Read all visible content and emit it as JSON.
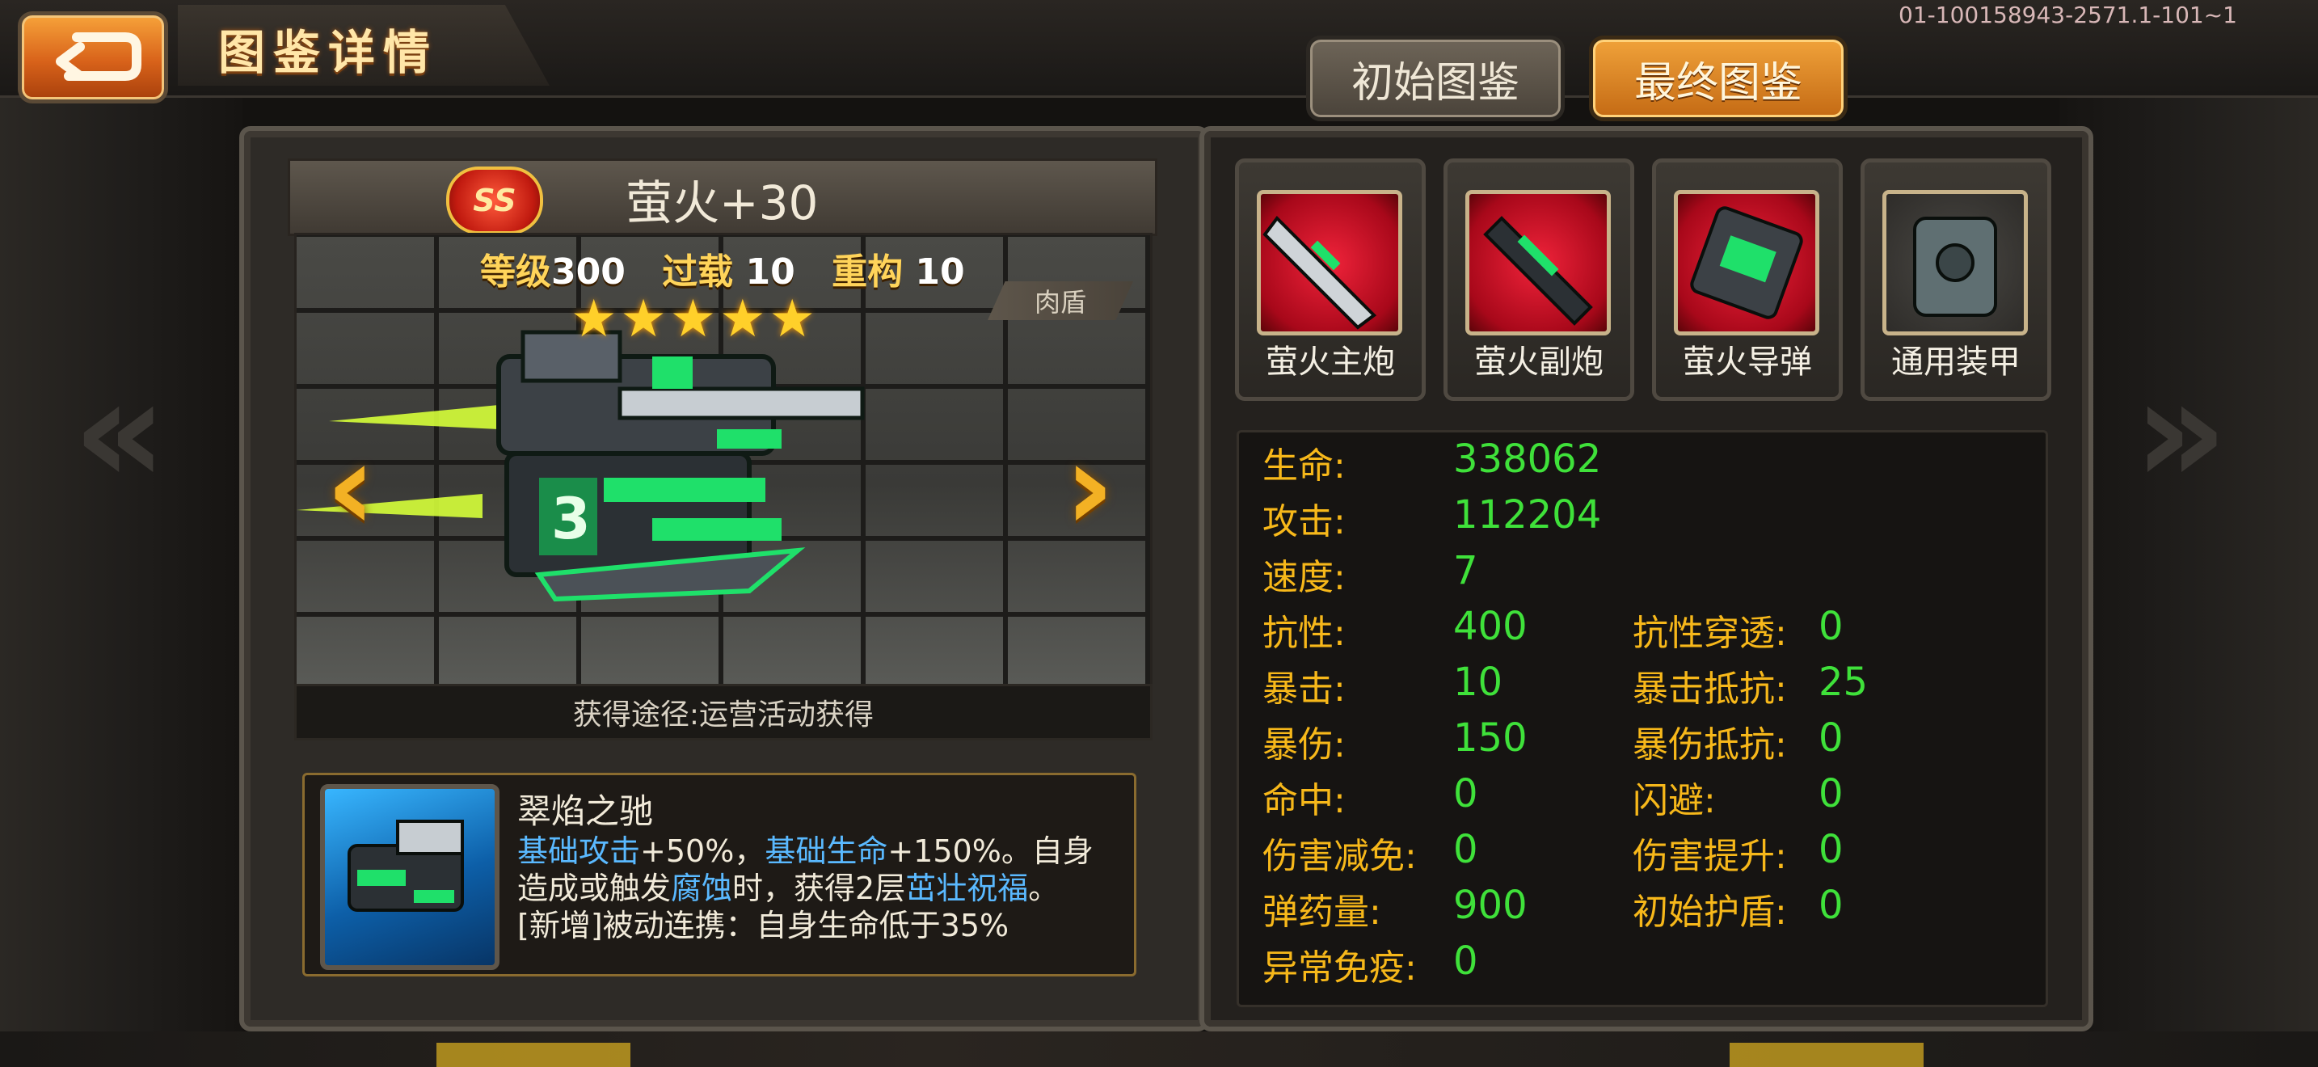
{
  "header": {
    "title": "图鉴详情",
    "build_id": "01-100158943-2571.1-101~1",
    "tabs": [
      {
        "label": "初始图鉴",
        "active": false
      },
      {
        "label": "最终图鉴",
        "active": true
      }
    ]
  },
  "unit": {
    "rank_badge": "SS",
    "name": "萤火+30",
    "level_label": "等级",
    "level": "300",
    "overload_label": "过载",
    "overload": "10",
    "rebuild_label": "重构",
    "rebuild": "10",
    "stars": 5,
    "role": "肉盾",
    "source": "获得途径:运营活动获得"
  },
  "skill": {
    "name": "翠焰之驰",
    "desc_parts": [
      {
        "t": "基础攻击",
        "kw": true
      },
      {
        "t": "+50%，",
        "kw": false
      },
      {
        "t": "基础生命",
        "kw": true
      },
      {
        "t": "+150%。自身造成或触发",
        "kw": false
      },
      {
        "t": "腐蚀",
        "kw": true
      },
      {
        "t": "时，获得2层",
        "kw": false
      },
      {
        "t": "茁壮祝福",
        "kw": true
      },
      {
        "t": "。",
        "kw": false
      },
      {
        "t": "[新增]被动连携：自身生命低于35%",
        "kw": false
      }
    ]
  },
  "equipment": [
    {
      "label": "萤火主炮",
      "icon": "main-cannon-icon",
      "bg": "red"
    },
    {
      "label": "萤火副炮",
      "icon": "sub-cannon-icon",
      "bg": "red"
    },
    {
      "label": "萤火导弹",
      "icon": "missile-icon",
      "bg": "red"
    },
    {
      "label": "通用装甲",
      "icon": "armor-icon",
      "bg": "gray"
    }
  ],
  "stats_left": [
    {
      "label": "生命:",
      "value": "338062"
    },
    {
      "label": "攻击:",
      "value": "112204"
    },
    {
      "label": "速度:",
      "value": "7"
    },
    {
      "label": "抗性:",
      "value": "400"
    },
    {
      "label": "暴击:",
      "value": "10"
    },
    {
      "label": "暴伤:",
      "value": "150"
    },
    {
      "label": "命中:",
      "value": "0"
    },
    {
      "label": "伤害减免:",
      "value": "0"
    },
    {
      "label": "弹药量:",
      "value": "900"
    },
    {
      "label": "异常免疫:",
      "value": "0"
    }
  ],
  "stats_right": [
    {
      "label": "抗性穿透:",
      "value": "0"
    },
    {
      "label": "暴击抵抗:",
      "value": "25"
    },
    {
      "label": "暴伤抵抗:",
      "value": "0"
    },
    {
      "label": "闪避:",
      "value": "0"
    },
    {
      "label": "伤害提升:",
      "value": "0"
    },
    {
      "label": "初始护盾:",
      "value": "0"
    }
  ],
  "colors": {
    "stat_label": "#f7b81a",
    "stat_value": "#3fe13a",
    "keyword": "#5ab9ff",
    "accent": "#e88a26"
  }
}
